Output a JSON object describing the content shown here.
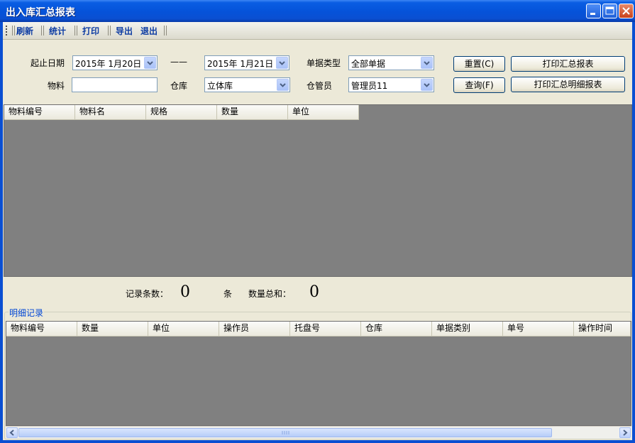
{
  "window": {
    "title": "出入库汇总报表"
  },
  "toolbar": {
    "items": [
      "刷新",
      "统计",
      "打印",
      "导出",
      "退出"
    ]
  },
  "filters": {
    "date_label": "起止日期",
    "start_date": "2015年 1月20日",
    "separator": "——",
    "end_date": "2015年 1月21日",
    "doc_type_label": "单据类型",
    "doc_type_value": "全部单据",
    "material_label": "物料",
    "material_value": "",
    "warehouse_label": "仓库",
    "warehouse_value": "立体库",
    "keeper_label": "仓管员",
    "keeper_value": "管理员11"
  },
  "buttons": {
    "reset": "重置(C)",
    "query": "查询(F)",
    "print_summary": "打印汇总报表",
    "print_detail": "打印汇总明细报表"
  },
  "summary_grid": {
    "columns": [
      "物料编号",
      "物料名",
      "规格",
      "数量",
      "单位"
    ],
    "rows": []
  },
  "summary": {
    "record_count_label": "记录条数：",
    "record_count": "0",
    "record_unit": "条",
    "qty_total_label": "数量总和：",
    "qty_total": "0"
  },
  "detail": {
    "group_label": "明细记录",
    "columns": [
      "物料编号",
      "数量",
      "单位",
      "操作员",
      "托盘号",
      "仓库",
      "单据类别",
      "单号",
      "操作时间"
    ],
    "rows": []
  },
  "colors": {
    "title_bar": "#0553da",
    "grid_bg": "#808080",
    "toolbar_text": "#0d3ca3",
    "group_label": "#0046d5"
  },
  "icons": [
    "minimize-icon",
    "maximize-icon",
    "close-icon",
    "chevron-down-icon",
    "scroll-left-icon",
    "scroll-right-icon"
  ]
}
